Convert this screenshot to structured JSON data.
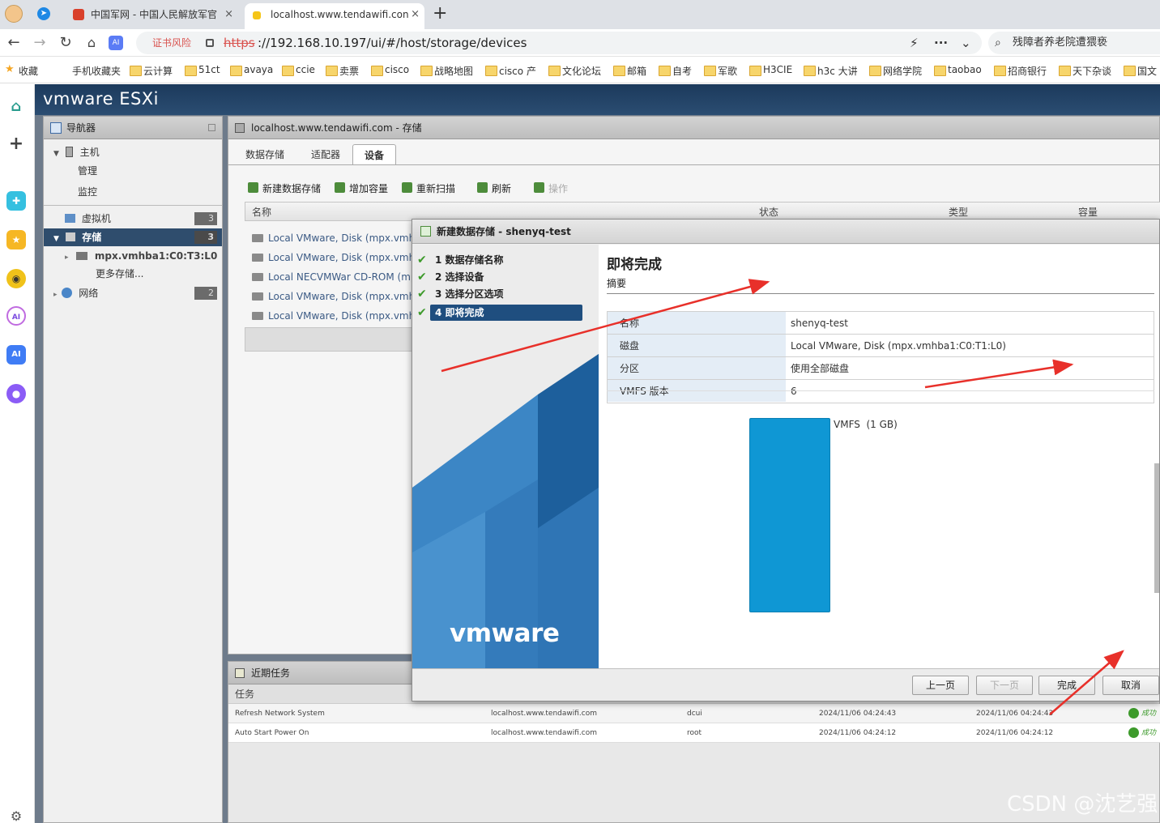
{
  "browser": {
    "tabs": [
      {
        "title": "中国军网 - 中国人民解放军官",
        "close": "×"
      },
      {
        "title": "localhost.www.tendawifi.con",
        "close": "×"
      }
    ],
    "new_tab": "+",
    "cert_warning": "证书风险",
    "url_scheme": "https",
    "url_rest": "://192.168.10.197/ui/#/host/storage/devices",
    "search_text": "残障者养老院遭猥亵",
    "bookmarks": [
      "收藏",
      "手机收藏夹",
      "云计算",
      "51ct",
      "avaya",
      "ccie",
      "卖票",
      "cisco",
      "战略地图",
      "cisco 产",
      "文化论坛",
      "邮箱",
      "自考",
      "军歌",
      "H3CIE",
      "h3c 大讲",
      "网络学院",
      "taobao",
      "招商银行",
      "天下杂谈",
      "国文"
    ]
  },
  "esxi": {
    "logo": "vmware ESXi",
    "navigator": {
      "title": "导航器",
      "host": "主机",
      "manage": "管理",
      "monitor": "监控",
      "vms": "虚拟机",
      "vms_count": "3",
      "storage": "存储",
      "storage_count": "3",
      "device": "mpx.vmhba1:C0:T3:L0",
      "more_storage": "更多存储...",
      "network": "网络",
      "network_count": "2"
    },
    "main": {
      "title": "localhost.www.tendawifi.com - 存储",
      "tabs": [
        "数据存储",
        "适配器",
        "设备"
      ],
      "toolbar": [
        "新建数据存储",
        "增加容量",
        "重新扫描",
        "刷新",
        "操作"
      ],
      "columns": [
        "名称",
        "状态",
        "类型",
        "容量"
      ],
      "rows": [
        "Local VMware, Disk (mpx.vmhba1",
        "Local VMware, Disk (mpx.vmhba1",
        "Local NECVMWar CD-ROM (mpx",
        "Local VMware, Disk (mpx.vmhba1",
        "Local VMware, Disk (mpx.vmhba1"
      ]
    },
    "tasks": {
      "title": "近期任务",
      "column": "任务",
      "rows": [
        {
          "task": "Refresh Network System",
          "target": "localhost.www.tendawifi.com",
          "user": "dcui",
          "queued": "2024/11/06 04:24:43",
          "started": "2024/11/06 04:24:43",
          "result": "成功"
        },
        {
          "task": "Auto Start Power On",
          "target": "localhost.www.tendawifi.com",
          "user": "root",
          "queued": "2024/11/06 04:24:12",
          "started": "2024/11/06 04:24:12",
          "result": "成功"
        }
      ]
    }
  },
  "dialog": {
    "title": "新建数据存储 - shenyq-test",
    "steps": [
      "1 数据存储名称",
      "2 选择设备",
      "3 选择分区选项",
      "4 即将完成"
    ],
    "brand": "vmware",
    "heading": "即将完成",
    "subheading": "摘要",
    "summary": [
      {
        "key": "名称",
        "value": "shenyq-test"
      },
      {
        "key": "磁盘",
        "value": "Local VMware, Disk (mpx.vmhba1:C0:T1:L0)"
      },
      {
        "key": "分区",
        "value": "使用全部磁盘"
      },
      {
        "key": "VMFS 版本",
        "value": "6"
      }
    ],
    "partition_label": "VMFS  (1 GB)",
    "buttons": {
      "back": "上一页",
      "next": "下一页",
      "finish": "完成",
      "cancel": "取消"
    }
  },
  "watermark": "CSDN @沈艺强",
  "colors": {
    "partition": "#0f97d4",
    "annotation_arrow": "#e8302a",
    "step_current": "#1f4e7f"
  }
}
